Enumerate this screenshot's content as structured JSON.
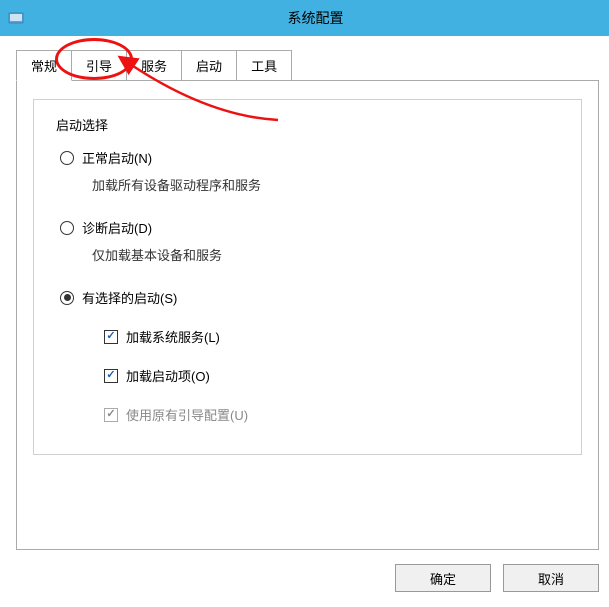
{
  "window": {
    "title": "系统配置"
  },
  "tabs": [
    {
      "label": "常规",
      "active": true
    },
    {
      "label": "引导",
      "active": false
    },
    {
      "label": "服务",
      "active": false
    },
    {
      "label": "启动",
      "active": false
    },
    {
      "label": "工具",
      "active": false
    }
  ],
  "fieldset": {
    "legend": "启动选择"
  },
  "radios": {
    "normal": {
      "label": "正常启动(N)",
      "desc": "加载所有设备驱动程序和服务",
      "checked": false
    },
    "diagnostic": {
      "label": "诊断启动(D)",
      "desc": "仅加载基本设备和服务",
      "checked": false
    },
    "selective": {
      "label": "有选择的启动(S)",
      "checked": true
    }
  },
  "checkboxes": {
    "loadServices": {
      "label": "加载系统服务(L)",
      "checked": true,
      "disabled": false
    },
    "loadStartup": {
      "label": "加载启动项(O)",
      "checked": true,
      "disabled": false
    },
    "useOriginal": {
      "label": "使用原有引导配置(U)",
      "checked": true,
      "disabled": true
    }
  },
  "buttons": {
    "ok": "确定",
    "cancel": "取消"
  }
}
